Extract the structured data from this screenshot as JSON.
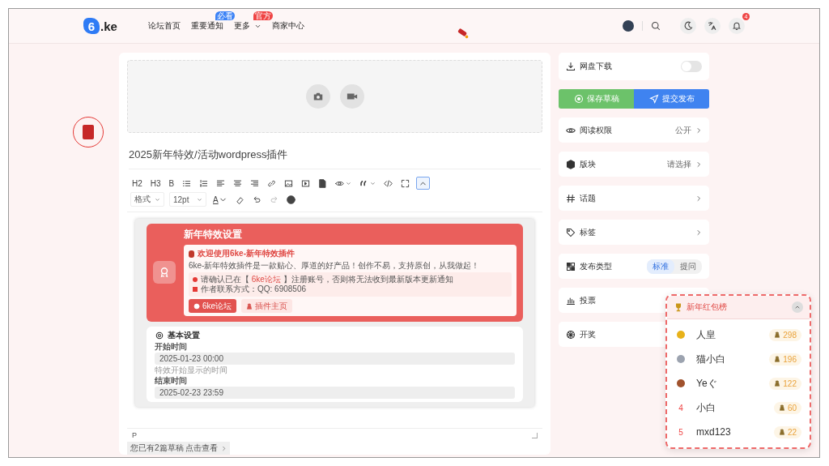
{
  "nav": {
    "logo_mark": "6",
    "logo_text": ".ke",
    "items": [
      {
        "label": "论坛首页"
      },
      {
        "label": "重要通知",
        "badge": "必看",
        "color": "#3b82f6",
        "dropdown": false
      },
      {
        "label": "更多",
        "badge": "官方",
        "color": "#ef4444",
        "dropdown": true
      },
      {
        "label": "商家中心"
      }
    ],
    "notification_count": "4"
  },
  "editor": {
    "title": "2025新年特效/活动wordpress插件",
    "toolbar": {
      "text_buttons": [
        "H2",
        "H3",
        "B"
      ],
      "collapse_selected": true,
      "format_select": "格式",
      "size_select": "12pt",
      "color_button": "A"
    },
    "document": {
      "banner_title": "新年特效设置",
      "welcome_title": "欢迎使用6ke-新年特效插件",
      "welcome_text": "6ke-新年特效插件是一款贴心、厚道的好产品！创作不易，支持原创，从我做起！",
      "notice_before": "请确认已在【",
      "notice_link": "6ke论坛",
      "notice_after": "】注册账号，否则将无法收到最新版本更新通知",
      "contact": "作者联系方式：QQ: 6908506",
      "buttons": [
        {
          "label": "6ke论坛",
          "kind": "primary"
        },
        {
          "label": "插件主页",
          "kind": "light"
        }
      ],
      "section_title": "基本设置",
      "fields": [
        {
          "label": "开始时间",
          "value": "2025-01-23 00:00",
          "help": "特效开始显示的时间"
        },
        {
          "label": "结束时间",
          "value": "2025-02-23 23:59"
        }
      ]
    },
    "status_path": "P",
    "drafts_notice": "您已有2篇草稿 点击查看"
  },
  "sidebar": {
    "rows": [
      {
        "kind": "toggle",
        "label": "网盘下载",
        "on": false
      }
    ],
    "save_button": "保存草稿",
    "publish_button": "提交发布",
    "settings": [
      {
        "kind": "link",
        "label": "阅读权限",
        "value": "公开"
      },
      {
        "kind": "link",
        "label": "版块",
        "value": "请选择"
      },
      {
        "kind": "link",
        "label": "话题"
      },
      {
        "kind": "link",
        "label": "标签"
      },
      {
        "kind": "segment",
        "label": "发布类型",
        "options": [
          {
            "label": "标准",
            "selected": true
          },
          {
            "label": "提问",
            "selected": false
          }
        ]
      },
      {
        "kind": "plain",
        "label": "投票"
      },
      {
        "kind": "plain",
        "label": "开奖"
      }
    ]
  },
  "leaderboard": {
    "title": "新年红包榜",
    "expanded": true,
    "entries": [
      {
        "kind": "medal",
        "color": "#e8b21a",
        "name": "人皇",
        "amount": "298"
      },
      {
        "kind": "medal",
        "color": "#9ca3af",
        "name": "猫小白",
        "amount": "196"
      },
      {
        "kind": "medal",
        "color": "#a0522d",
        "name": "Yeぐ",
        "amount": "122"
      },
      {
        "kind": "number",
        "rank": "4",
        "name": "小白",
        "amount": "60"
      },
      {
        "kind": "number",
        "rank": "5",
        "name": "mxd123",
        "amount": "22"
      }
    ]
  }
}
